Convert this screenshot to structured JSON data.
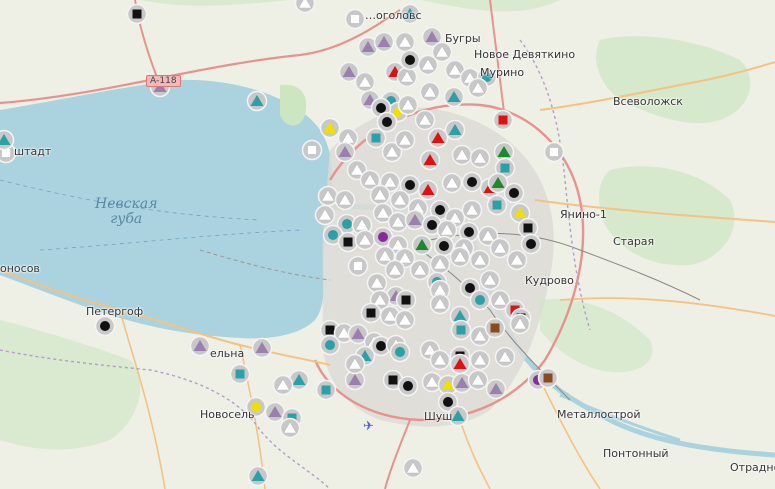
{
  "map": {
    "water_label": "Невская\nгуба",
    "road_shield": "А-118",
    "place_labels": [
      {
        "id": "zelenogorsk",
        "text": "Зеленогорск (partial)",
        "display": "…оголовс"
      },
      {
        "id": "bugry",
        "text": "Бугры"
      },
      {
        "id": "novoe_devyatkino",
        "text": "Новое Девяткино"
      },
      {
        "id": "murino",
        "text": "Мурино"
      },
      {
        "id": "vsevolozhsk",
        "text": "Всеволожск"
      },
      {
        "id": "kronshtadt",
        "text": "штадт"
      },
      {
        "id": "yanino1",
        "text": "Янино-1"
      },
      {
        "id": "staraya",
        "text": "Старая"
      },
      {
        "id": "lomonosov",
        "text": "оносов"
      },
      {
        "id": "kudrovo",
        "text": "Кудрово"
      },
      {
        "id": "petergof",
        "text": "Петергоф"
      },
      {
        "id": "strelna",
        "text": "ельна"
      },
      {
        "id": "novoselye",
        "text": "Новосель"
      },
      {
        "id": "shushary",
        "text": "Шуш"
      },
      {
        "id": "metallostroy",
        "text": "Металлострой"
      },
      {
        "id": "pontonny",
        "text": "Понтонный"
      },
      {
        "id": "otradnoe",
        "text": "Отрадно"
      }
    ],
    "marker_colors": {
      "purple-triangle": "#9a7fb0",
      "teal-triangle": "#2aa0a8",
      "white-triangle": "#ffffff",
      "black-square": "#111111",
      "black-circle": "#111111",
      "teal-circle": "#2aa0a8",
      "teal-square": "#2aa0a8",
      "red-triangle": "#e01010",
      "red-square": "#e01010",
      "yellow-triangle": "#f0e000",
      "yellow-circle": "#f0e000",
      "green-triangle": "#1a8a2a",
      "purple-circle": "#8a2a9a",
      "brown-square": "#8a4a1a",
      "white-square": "#ffffff"
    }
  }
}
